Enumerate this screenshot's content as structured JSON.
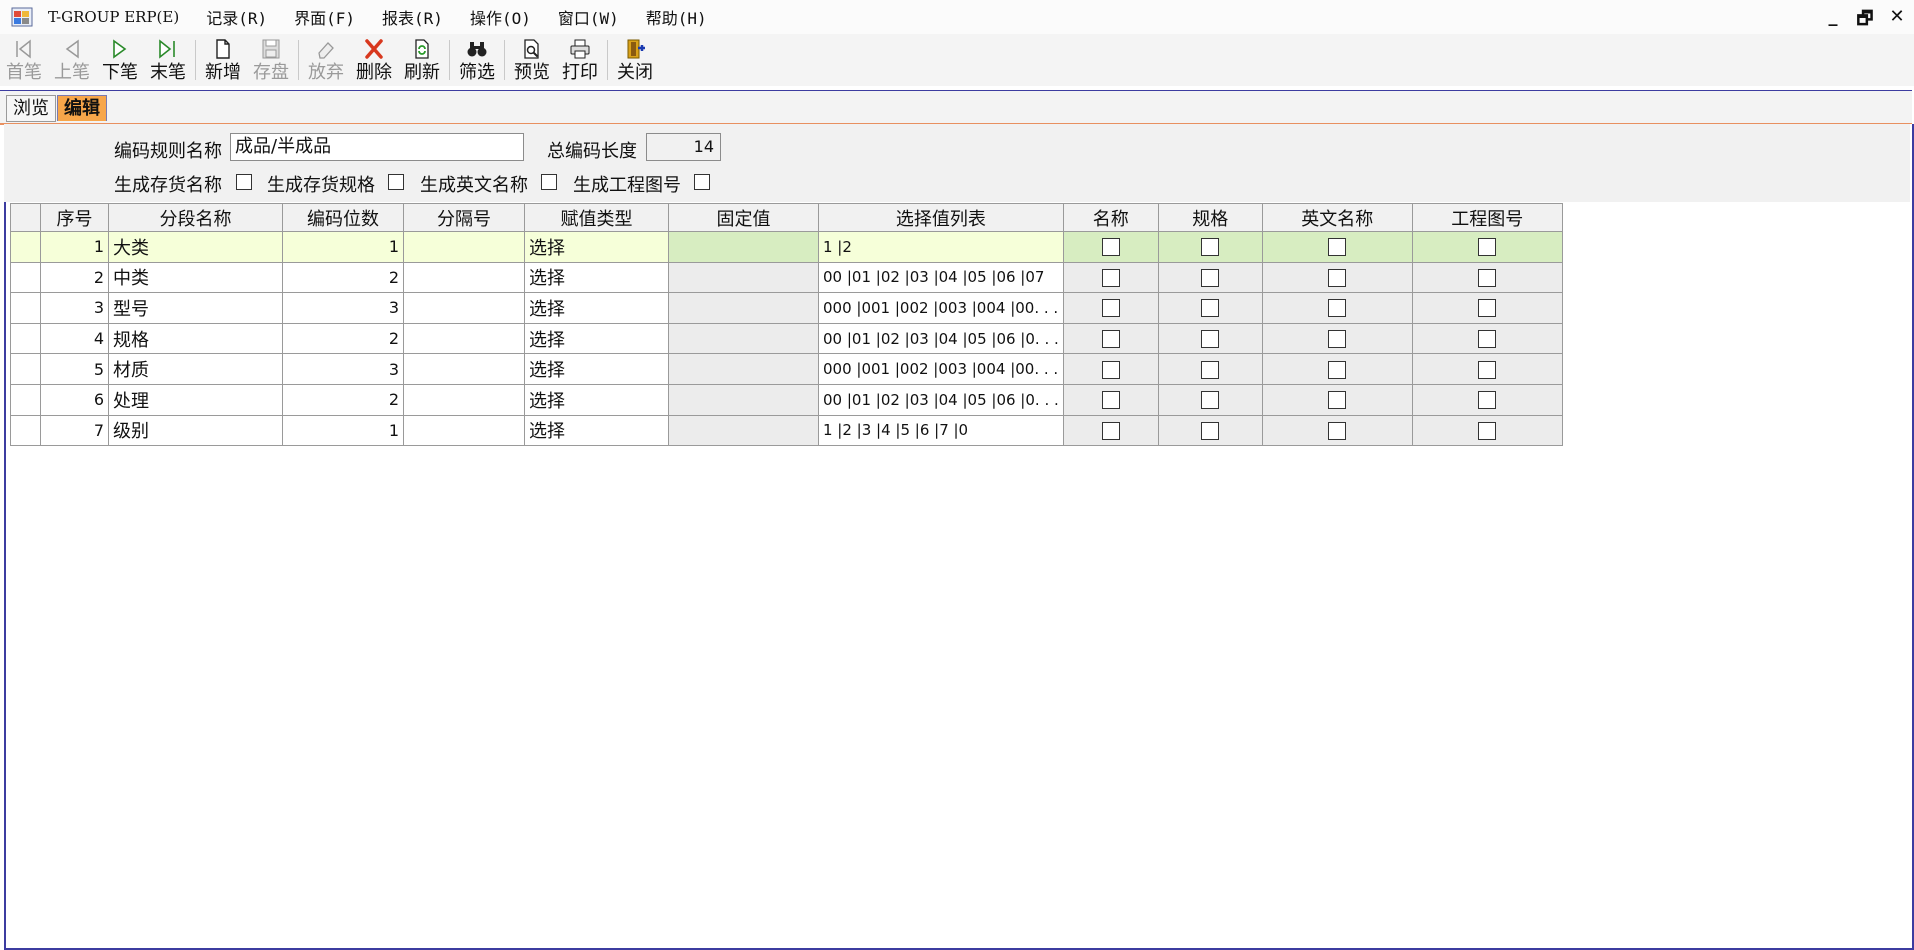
{
  "menu": {
    "items": [
      "T-GROUP ERP(E)",
      "记录(R)",
      "界面(F)",
      "报表(R)",
      "操作(O)",
      "窗口(W)",
      "帮助(H)"
    ],
    "window_controls": [
      "_",
      "🗗",
      "✕"
    ]
  },
  "toolbar": {
    "first": "首笔",
    "prev": "上笔",
    "next": "下笔",
    "last": "末笔",
    "add": "新增",
    "save": "存盘",
    "discard": "放弃",
    "delete": "删除",
    "refresh": "刷新",
    "filter": "筛选",
    "preview": "预览",
    "print": "打印",
    "close": "关闭"
  },
  "tabs": {
    "browse": "浏览",
    "edit": "编辑"
  },
  "form": {
    "rule_name_label": "编码规则名称",
    "rule_name_value": "成品/半成品",
    "total_length_label": "总编码长度",
    "total_length_value": "14",
    "gen_name_label": "生成存货名称",
    "gen_spec_label": "生成存货规格",
    "gen_en_label": "生成英文名称",
    "gen_drawing_label": "生成工程图号"
  },
  "grid": {
    "headers": [
      "序号",
      "分段名称",
      "编码位数",
      "分隔号",
      "赋值类型",
      "固定值",
      "选择值列表",
      "名称",
      "规格",
      "英文名称",
      "工程图号"
    ],
    "rows": [
      {
        "seq": "1",
        "name": "大类",
        "digits": "1",
        "sep": "",
        "type": "选择",
        "fixed": "",
        "values": "1 |2"
      },
      {
        "seq": "2",
        "name": "中类",
        "digits": "2",
        "sep": "",
        "type": "选择",
        "fixed": "",
        "values": "00 |01 |02 |03 |04 |05 |06 |07"
      },
      {
        "seq": "3",
        "name": "型号",
        "digits": "3",
        "sep": "",
        "type": "选择",
        "fixed": "",
        "values": "000 |001 |002 |003 |004 |00. . ."
      },
      {
        "seq": "4",
        "name": "规格",
        "digits": "2",
        "sep": "",
        "type": "选择",
        "fixed": "",
        "values": "00 |01 |02 |03 |04 |05 |06 |0. . ."
      },
      {
        "seq": "5",
        "name": "材质",
        "digits": "3",
        "sep": "",
        "type": "选择",
        "fixed": "",
        "values": "000 |001 |002 |003 |004 |00. . ."
      },
      {
        "seq": "6",
        "name": "处理",
        "digits": "2",
        "sep": "",
        "type": "选择",
        "fixed": "",
        "values": "00 |01 |02 |03 |04 |05 |06 |0. . ."
      },
      {
        "seq": "7",
        "name": "级别",
        "digits": "1",
        "sep": "",
        "type": "选择",
        "fixed": "",
        "values": "1 |2 |3 |4 |5 |6 |7 |0"
      }
    ]
  },
  "colors": {
    "accent_tab": "#f7a64a",
    "frame_border": "#3c3ca0",
    "selected_row": "#f6ffd9",
    "selected_row_readonly": "#d7edc1"
  }
}
